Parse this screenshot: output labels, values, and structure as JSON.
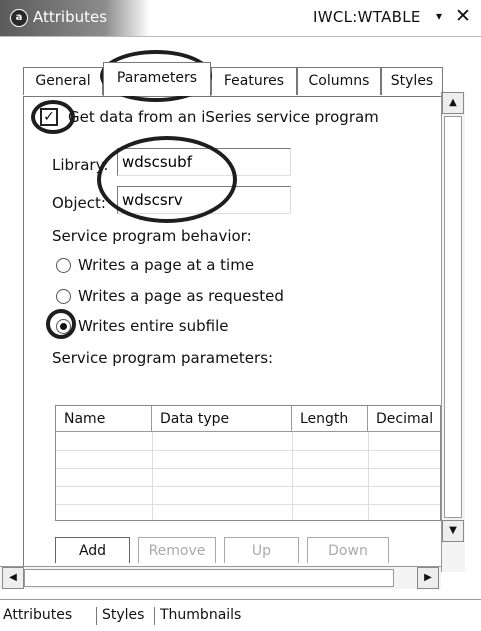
{
  "window": {
    "icon": "attributes-icon",
    "title": "Attributes",
    "context": "IWCL:WTABLE",
    "dropdown_glyph": "▾",
    "close_glyph": "✕"
  },
  "tabs": [
    {
      "label": "General",
      "mnemonic": "G"
    },
    {
      "label": "Parameters",
      "mnemonic": "P"
    },
    {
      "label": "Features",
      "mnemonic": "F"
    },
    {
      "label": "Columns",
      "mnemonic": "C"
    },
    {
      "label": "Styles",
      "mnemonic": "S"
    }
  ],
  "form": {
    "get_data_checkbox": {
      "label": "Get data from an iSeries service program",
      "checked": true
    },
    "library": {
      "label": "Library:",
      "value": "wdscsubf"
    },
    "object": {
      "label": "Object:",
      "value": "wdscsrv"
    },
    "behavior_heading": "Service program behavior:",
    "behavior_options": [
      {
        "label": "Writes a page at a time",
        "checked": false
      },
      {
        "label": "Writes a page as requested",
        "checked": false
      },
      {
        "label": "Writes entire subfile",
        "checked": true
      }
    ],
    "parameters_heading": "Service program parameters:",
    "table_columns": [
      "Name",
      "Data type",
      "Length",
      "Decimal"
    ]
  },
  "buttons": {
    "add": "Add",
    "remove": "Remove",
    "up": "Up",
    "down": "Down"
  },
  "bottom_tabs": [
    "Attributes",
    "Styles",
    "Thumbnails"
  ]
}
